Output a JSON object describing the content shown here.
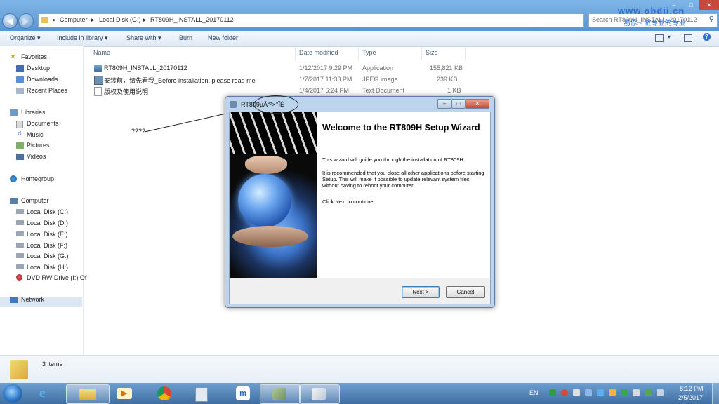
{
  "explorer": {
    "address": {
      "segments": [
        "Computer",
        "Local Disk (G:)",
        "RT809H_INSTALL_20170112"
      ]
    },
    "search_placeholder": "Search RT809H_INSTALL_20170112",
    "toolbar": {
      "organize": "Organize ▾",
      "include": "Include in library ▾",
      "share": "Share with ▾",
      "burn": "Burn",
      "newfolder": "New folder"
    },
    "nav": {
      "favorites": "Favorites",
      "desktop": "Desktop",
      "downloads": "Downloads",
      "recent": "Recent Places",
      "libraries": "Libraries",
      "documents": "Documents",
      "music": "Music",
      "pictures": "Pictures",
      "videos": "Videos",
      "homegroup": "Homegroup",
      "computer": "Computer",
      "drive_c": "Local Disk (C:)",
      "drive_d": "Local Disk (D:)",
      "drive_e": "Local Disk (E:)",
      "drive_f": "Local Disk (F:)",
      "drive_g": "Local Disk (G:)",
      "drive_h": "Local Disk (H:)",
      "dvd": "DVD RW Drive (I:) Of",
      "network": "Network"
    },
    "columns": {
      "name": "Name",
      "date": "Date modified",
      "type": "Type",
      "size": "Size"
    },
    "files": [
      {
        "name": "RT809H_INSTALL_20170112",
        "date": "1/12/2017 9:29 PM",
        "type": "Application",
        "size": "155,821 KB"
      },
      {
        "name": "安装前，请先看我_Before installation, please read me",
        "date": "1/7/2017 11:33 PM",
        "type": "JPEG image",
        "size": "239 KB"
      },
      {
        "name": "版权及使用说明",
        "date": "1/4/2017 6:24 PM",
        "type": "Text Document",
        "size": "1 KB"
      }
    ],
    "status": "3 items"
  },
  "watermark": {
    "line1": "www.obdii.cn",
    "line2": "易修 - 做专业的专业"
  },
  "annotation": "????",
  "dialog": {
    "title": "RT809µÄ°²×°ÏÈ",
    "heading": "Welcome to the RT809H Setup Wizard",
    "p1": "This wizard will guide you through the installation of RT809H.",
    "p2": "It is recommended that you close all other applications before starting Setup. This will make it possible to update relevant system files without having to reboot your computer.",
    "p3": "Click Next to continue.",
    "next": "Next >",
    "cancel": "Cancel"
  },
  "taskbar": {
    "lang": "EN",
    "time": "8:12 PM",
    "date": "2/5/2017"
  }
}
